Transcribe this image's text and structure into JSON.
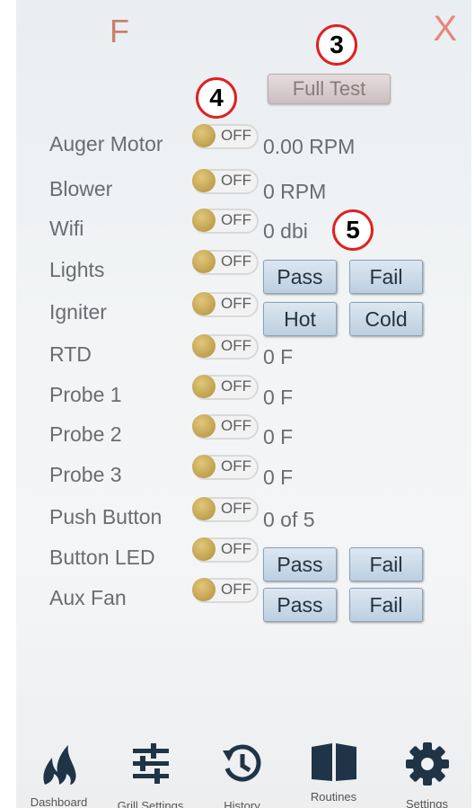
{
  "header": {
    "unit_label": "F",
    "close_label": "X",
    "full_test_label": "Full Test"
  },
  "callouts": [
    "3",
    "4",
    "5"
  ],
  "off_label": "OFF",
  "tests": [
    {
      "label": "Auger Motor",
      "reading": "0.00 RPM"
    },
    {
      "label": "Blower",
      "reading": "0 RPM"
    },
    {
      "label": "Wifi",
      "reading": "0 dbi"
    },
    {
      "label": "Lights",
      "buttons": [
        "Pass",
        "Fail"
      ]
    },
    {
      "label": "Igniter",
      "buttons": [
        "Hot",
        "Cold"
      ]
    },
    {
      "label": "RTD",
      "reading": "0 F"
    },
    {
      "label": "Probe 1",
      "reading": "0 F"
    },
    {
      "label": "Probe 2",
      "reading": "0 F"
    },
    {
      "label": "Probe 3",
      "reading": "0 F"
    },
    {
      "label": "Push Button",
      "reading": "0 of 5"
    },
    {
      "label": "Button LED",
      "buttons": [
        "Pass",
        "Fail"
      ]
    },
    {
      "label": "Aux Fan",
      "buttons": [
        "Pass",
        "Fail"
      ]
    }
  ],
  "nav": [
    {
      "label": "Dashboard",
      "icon": "flame-icon"
    },
    {
      "label": "Grill Settings",
      "icon": "sliders-icon"
    },
    {
      "label": "History",
      "icon": "history-icon"
    },
    {
      "label": "Routines",
      "icon": "book-icon"
    },
    {
      "label": "Settings",
      "icon": "gear-icon"
    }
  ],
  "colors": {
    "accent": "#c9806b",
    "toggle_knob": "#c9a449",
    "button_bg": "#c8d8e8",
    "callout_ring": "#e02020"
  }
}
